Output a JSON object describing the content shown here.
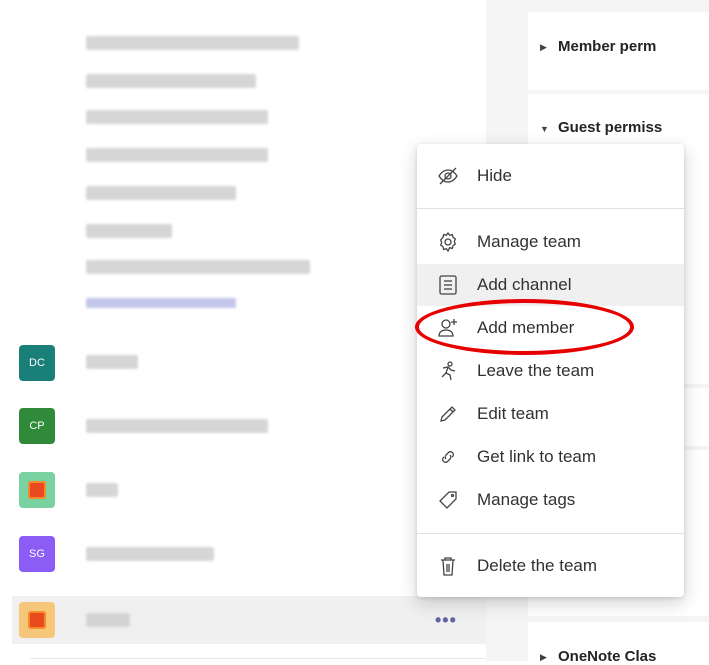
{
  "teams": [
    {
      "initials": "DC",
      "color": "#1b7f79"
    },
    {
      "initials": "CP",
      "color": "#2f8a3a"
    },
    {
      "initials": "",
      "color": "#7ad2a0"
    },
    {
      "initials": "SG",
      "color": "#8b5cf6"
    },
    {
      "initials": "",
      "color": "#f6c77b"
    }
  ],
  "settings_sections": {
    "member_permissions": "Member perm",
    "guest_permissions": "Guest permiss",
    "onenote": "OneNote Clas"
  },
  "context_menu": {
    "hide": "Hide",
    "manage_team": "Manage team",
    "add_channel": "Add channel",
    "add_member": "Add member",
    "leave_team": "Leave the team",
    "edit_team": "Edit team",
    "get_link": "Get link to team",
    "manage_tags": "Manage tags",
    "delete_team": "Delete the team"
  },
  "more_options": "•••",
  "annotation_color": "#e60000"
}
